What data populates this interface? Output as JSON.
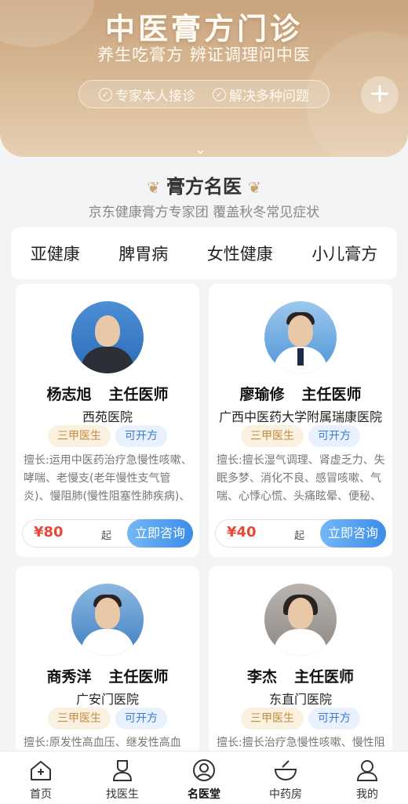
{
  "banner": {
    "title": "中医膏方门诊",
    "subtitle": "养生吃膏方 辨证调理问中医",
    "pills": [
      "专家本人接诊",
      "解决多种问题"
    ]
  },
  "section": {
    "title": "膏方名医",
    "subtitle": "京东健康膏方专家团 覆盖秋冬常见症状"
  },
  "tabs": [
    "亚健康",
    "脾胃病",
    "女性健康",
    "小儿膏方"
  ],
  "doctors": [
    {
      "name": "杨志旭",
      "title": "主任医师",
      "hospital": "西苑医院",
      "badges": [
        "三甲医生",
        "可开方"
      ],
      "desc": "擅长:运用中医药治疗急慢性咳嗽、哮喘、老慢支(老年慢性支气管炎)、慢阻肺(慢性阻塞性肺疾病)、肺纤...",
      "price": "¥80",
      "price_suffix": "起",
      "consult_label": "立即咨询"
    },
    {
      "name": "廖瑜修",
      "title": "主任医师",
      "hospital": "广西中医药大学附属瑞康医院",
      "badges": [
        "三甲医生",
        "可开方"
      ],
      "desc": "擅长:擅长湿气调理、肾虚乏力、失眠多梦、消化不良、感冒咳嗽、气喘、心悸心慌、头痛眩晕、便秘、月经...",
      "price": "¥40",
      "price_suffix": "起",
      "consult_label": "立即咨询"
    },
    {
      "name": "商秀洋",
      "title": "主任医师",
      "hospital": "广安门医院",
      "badges": [
        "三甲医生",
        "可开方"
      ],
      "desc": "擅长:原发性高血压、继发性高血压、"
    },
    {
      "name": "李杰",
      "title": "主任医师",
      "hospital": "东直门医院",
      "badges": [
        "三甲医生",
        "可开方"
      ],
      "desc": "擅长:擅长治疗急慢性咳嗽、慢性阻"
    }
  ],
  "bottom_nav": [
    {
      "label": "首页",
      "icon": "home-icon"
    },
    {
      "label": "找医生",
      "icon": "doctor-icon"
    },
    {
      "label": "名医堂",
      "icon": "famous-doctor-icon",
      "active": true
    },
    {
      "label": "中药房",
      "icon": "herb-bowl-icon"
    },
    {
      "label": "我的",
      "icon": "user-icon"
    }
  ],
  "colors": {
    "banner_gold": "#c9a47e",
    "price_red": "#e8483a",
    "consult_blue": "#3b8de8",
    "badge_gold_text": "#c48a3a",
    "badge_blue_text": "#3b7ad8"
  }
}
